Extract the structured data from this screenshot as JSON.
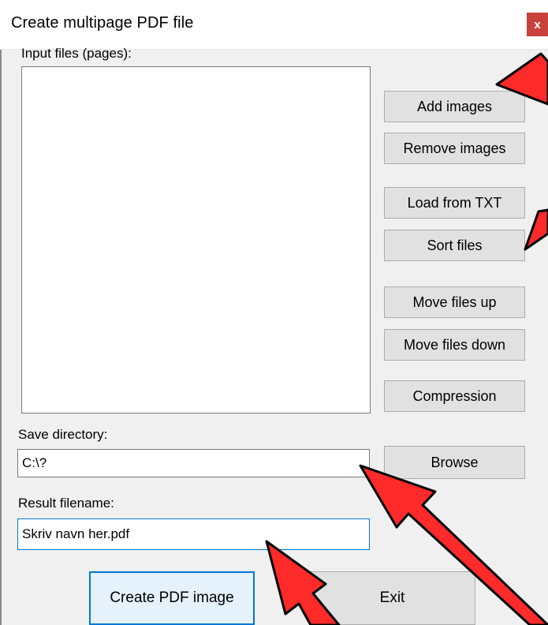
{
  "window": {
    "title": "Create multipage PDF file",
    "close_label": "x"
  },
  "input_files_label": "Input files (pages):",
  "buttons": {
    "add_images": "Add images",
    "remove_images": "Remove images",
    "load_from_txt": "Load from TXT",
    "sort_files": "Sort files",
    "move_up": "Move files up",
    "move_down": "Move files down",
    "compression": "Compression",
    "browse": "Browse",
    "create_pdf": "Create PDF image",
    "exit": "Exit"
  },
  "save_directory": {
    "label": "Save directory:",
    "value": "C:\\?"
  },
  "result_filename": {
    "label": "Result filename:",
    "value": "Skriv navn her.pdf"
  },
  "colors": {
    "arrow_fill": "#ff2a2a",
    "focus_border": "#0078d7",
    "close_bg": "#c8413a"
  }
}
